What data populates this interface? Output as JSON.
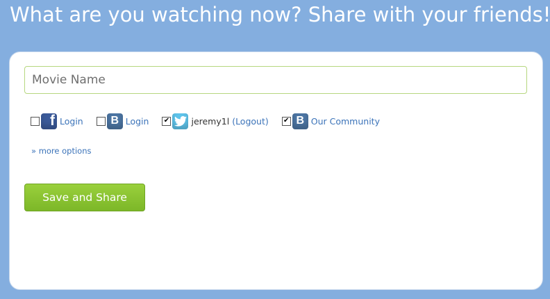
{
  "header": {
    "title": "What are you watching now? Share with your friends!"
  },
  "form": {
    "movie_placeholder": "Movie Name",
    "options": [
      {
        "service": "facebook",
        "icon": "facebook-icon",
        "icon_text": "f",
        "checked": false,
        "label": "Login"
      },
      {
        "service": "vkontakte",
        "icon": "vk-icon",
        "icon_text": "B",
        "checked": false,
        "label": "Login"
      },
      {
        "service": "twitter",
        "icon": "twitter-icon",
        "icon_text": "t",
        "checked": true,
        "username": "jeremy1l",
        "logout_label": "(Logout)"
      },
      {
        "service": "vkontakte-community",
        "icon": "vk-icon",
        "icon_text": "B",
        "checked": true,
        "label": "Our Community"
      }
    ],
    "more_options_label": "» more options",
    "submit_label": "Save and Share"
  },
  "colors": {
    "background": "#84aedf",
    "link": "#3b73b9",
    "button": "#8cc634",
    "input_border": "#b6d77f",
    "facebook": "#3b5a9a",
    "vk": "#4c75a3",
    "twitter": "#5ec3ea"
  }
}
